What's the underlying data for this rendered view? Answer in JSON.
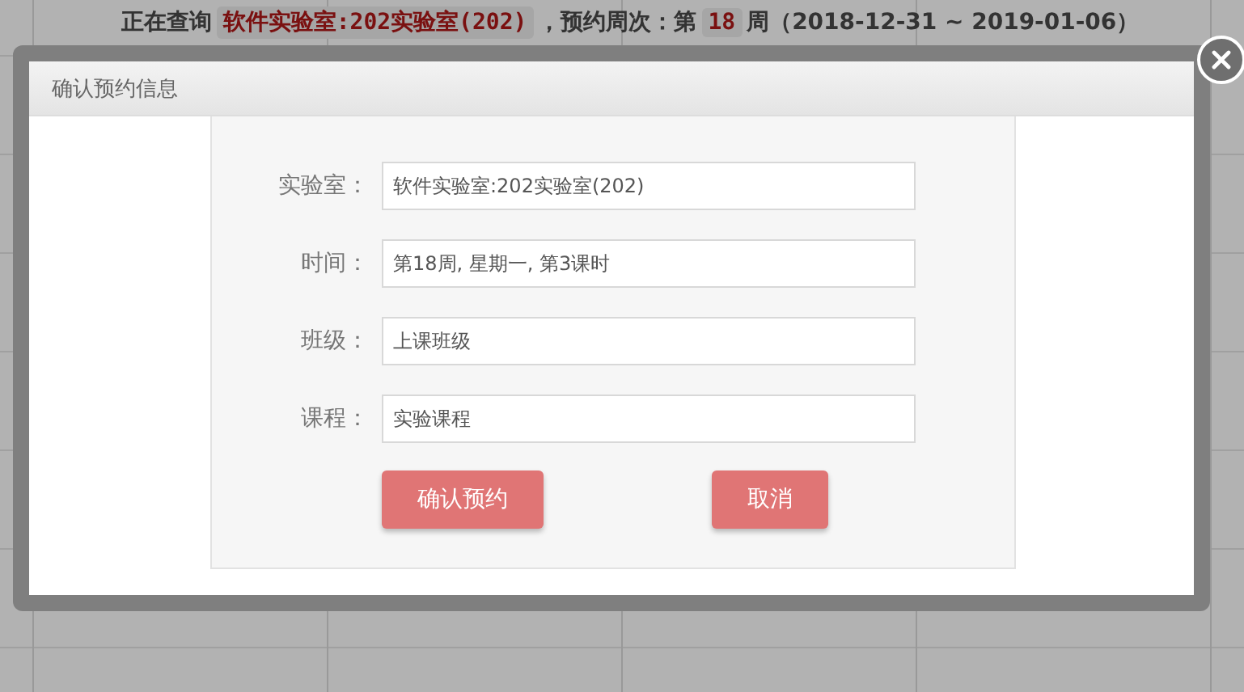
{
  "header": {
    "prefix": "正在查询",
    "lab": "软件实验室:202实验室(202)",
    "middle": "，预约周次：第",
    "week": "18",
    "suffix": "周（2018-12-31 ~ 2019-01-06）"
  },
  "dialog": {
    "title": "确认预约信息",
    "fields": [
      {
        "label": "实验室：",
        "value": "软件实验室:202实验室(202)"
      },
      {
        "label": "时间：",
        "value": "第18周, 星期一, 第3课时"
      },
      {
        "label": "班级：",
        "value": "上课班级"
      },
      {
        "label": "课程：",
        "value": "实验课程"
      }
    ],
    "buttons": [
      "确认预约",
      "取消"
    ]
  }
}
